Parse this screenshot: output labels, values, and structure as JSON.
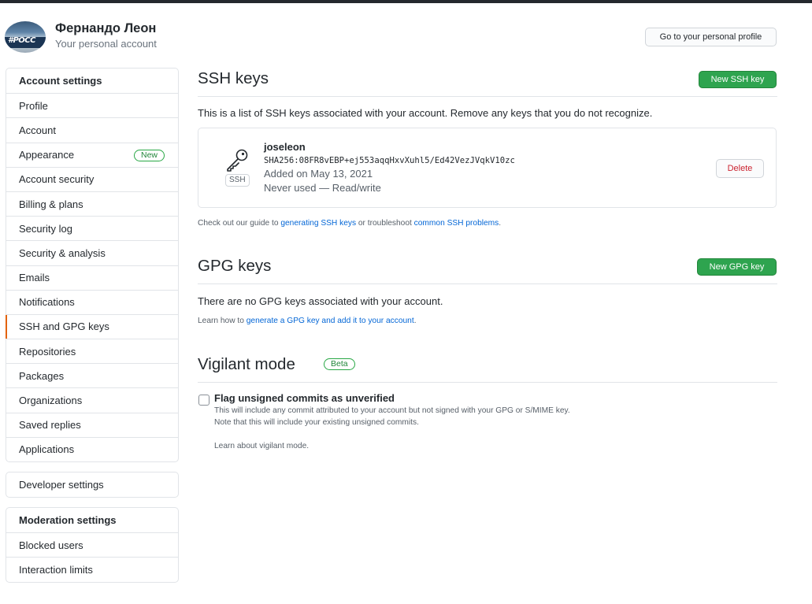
{
  "header": {
    "user_name": "Фернандо Леон",
    "account_type": "Your personal account",
    "avatar_text": "#POCC",
    "profile_button": "Go to your personal profile"
  },
  "sidebar": {
    "account_settings": {
      "heading": "Account settings",
      "items": [
        {
          "label": "Profile"
        },
        {
          "label": "Account"
        },
        {
          "label": "Appearance",
          "badge": "New"
        },
        {
          "label": "Account security"
        },
        {
          "label": "Billing & plans"
        },
        {
          "label": "Security log"
        },
        {
          "label": "Security & analysis"
        },
        {
          "label": "Emails"
        },
        {
          "label": "Notifications"
        },
        {
          "label": "SSH and GPG keys",
          "active": true
        },
        {
          "label": "Repositories"
        },
        {
          "label": "Packages"
        },
        {
          "label": "Organizations"
        },
        {
          "label": "Saved replies"
        },
        {
          "label": "Applications"
        }
      ]
    },
    "developer_settings": "Developer settings",
    "moderation_settings": {
      "heading": "Moderation settings",
      "items": [
        {
          "label": "Blocked users"
        },
        {
          "label": "Interaction limits"
        }
      ]
    }
  },
  "ssh": {
    "title": "SSH keys",
    "new_button": "New SSH key",
    "description": "This is a list of SSH keys associated with your account. Remove any keys that you do not recognize.",
    "key": {
      "badge": "SSH",
      "title": "joseleon",
      "fingerprint": "SHA256:08FR8vEBP+ej553aqqHxvXuhl5/Ed42VezJVqkV10zc",
      "added": "Added on May 13, 2021",
      "usage": "Never used — Read/write",
      "delete_button": "Delete"
    },
    "guide_prefix": "Check out our guide to ",
    "guide_link1": "generating SSH keys",
    "guide_middle": " or troubleshoot ",
    "guide_link2": "common SSH problems",
    "guide_suffix": "."
  },
  "gpg": {
    "title": "GPG keys",
    "new_button": "New GPG key",
    "empty_message": "There are no GPG keys associated with your account.",
    "learn_prefix": "Learn how to ",
    "learn_link": "generate a GPG key and add it to your account",
    "learn_suffix": "."
  },
  "vigilant": {
    "title": "Vigilant mode",
    "badge": "Beta",
    "checkbox_label": "Flag unsigned commits as unverified",
    "checked": false,
    "note1": "This will include any commit attributed to your account but not signed with your GPG or S/MIME key.",
    "note2": "Note that this will include your existing unsigned commits.",
    "learn_link": "Learn about vigilant mode."
  },
  "colors": {
    "accent_green": "#2ea44f",
    "link_blue": "#0366d6",
    "active_marker": "#e36209",
    "danger": "#cb2431"
  }
}
